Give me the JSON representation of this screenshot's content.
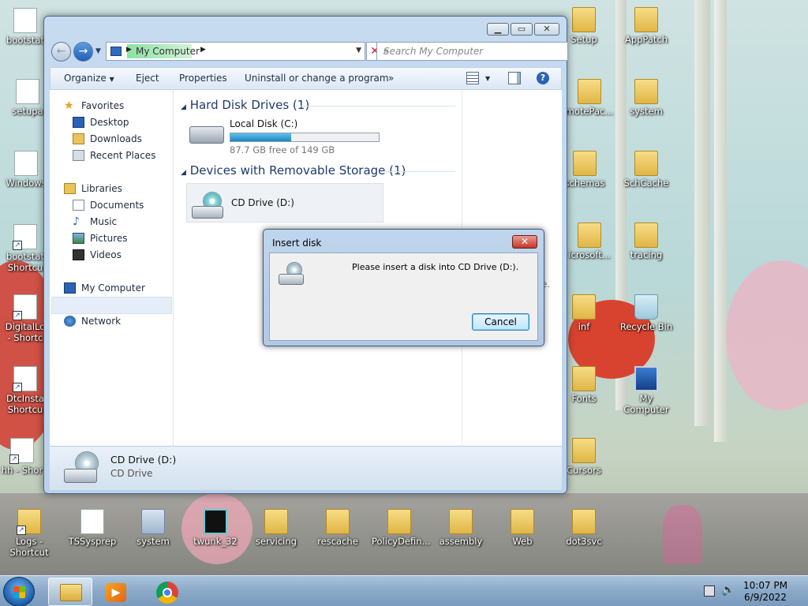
{
  "desktop": {
    "icons": [
      {
        "label": "bootstat"
      },
      {
        "label": "setupa"
      },
      {
        "label": "Windows"
      },
      {
        "label": "bootstat"
      },
      {
        "label": "Shortcu"
      },
      {
        "label": "DigitalLo"
      },
      {
        "label": "- Shortc"
      },
      {
        "label": "DtcInsta"
      },
      {
        "label": "Shortcu"
      },
      {
        "label": "hh - Shor"
      },
      {
        "label": "Logs -"
      },
      {
        "label": "Shortcut"
      },
      {
        "label": "TSSysprep"
      },
      {
        "label": "system"
      },
      {
        "label": "twunk_32"
      },
      {
        "label": "servicing"
      },
      {
        "label": "rescache"
      },
      {
        "label": "PolicyDefin..."
      },
      {
        "label": "assembly"
      },
      {
        "label": "Web"
      },
      {
        "label": "dot3svc"
      },
      {
        "label": "Setup"
      },
      {
        "label": "AppPatch"
      },
      {
        "label": "motePac..."
      },
      {
        "label": "system"
      },
      {
        "label": "schemas"
      },
      {
        "label": "SchCache"
      },
      {
        "label": "icrosoft..."
      },
      {
        "label": "tracing"
      },
      {
        "label": "inf"
      },
      {
        "label": "Recycle Bin"
      },
      {
        "label": "Fonts"
      },
      {
        "label": "My Computer"
      },
      {
        "label": "Cursors"
      }
    ]
  },
  "explorer": {
    "address": {
      "location": "My Computer"
    },
    "search": {
      "placeholder": "Search My Computer"
    },
    "toolbar": {
      "organize": "Organize",
      "eject": "Eject",
      "properties": "Properties",
      "uninstall": "Uninstall or change a program",
      "more": "»"
    },
    "nav": {
      "favorites": "Favorites",
      "desktop": "Desktop",
      "downloads": "Downloads",
      "recent": "Recent Places",
      "libraries": "Libraries",
      "documents": "Documents",
      "music": "Music",
      "pictures": "Pictures",
      "videos": "Videos",
      "my_computer": "My Computer",
      "network": "Network"
    },
    "groups": {
      "hdd": "Hard Disk Drives (1)",
      "removable": "Devices with Removable Storage (1)"
    },
    "local_disk": {
      "name": "Local Disk (C:)",
      "free": "87.7 GB free of 149 GB",
      "used_fraction": 0.41
    },
    "cd_drive": {
      "name": "CD Drive (D:)"
    },
    "details_partial": "le.",
    "status": {
      "name": "CD Drive (D:)",
      "type": "CD Drive"
    }
  },
  "dialog": {
    "title": "Insert disk",
    "close": "✕",
    "message": "Please insert a disk into CD Drive (D:).",
    "cancel": "Cancel"
  },
  "taskbar": {
    "time": "10:07 PM",
    "date": "6/9/2022"
  },
  "colors": {
    "accent": "#1e86c4",
    "dialog_close": "#c2382a",
    "group_header": "#1e3a6e"
  }
}
